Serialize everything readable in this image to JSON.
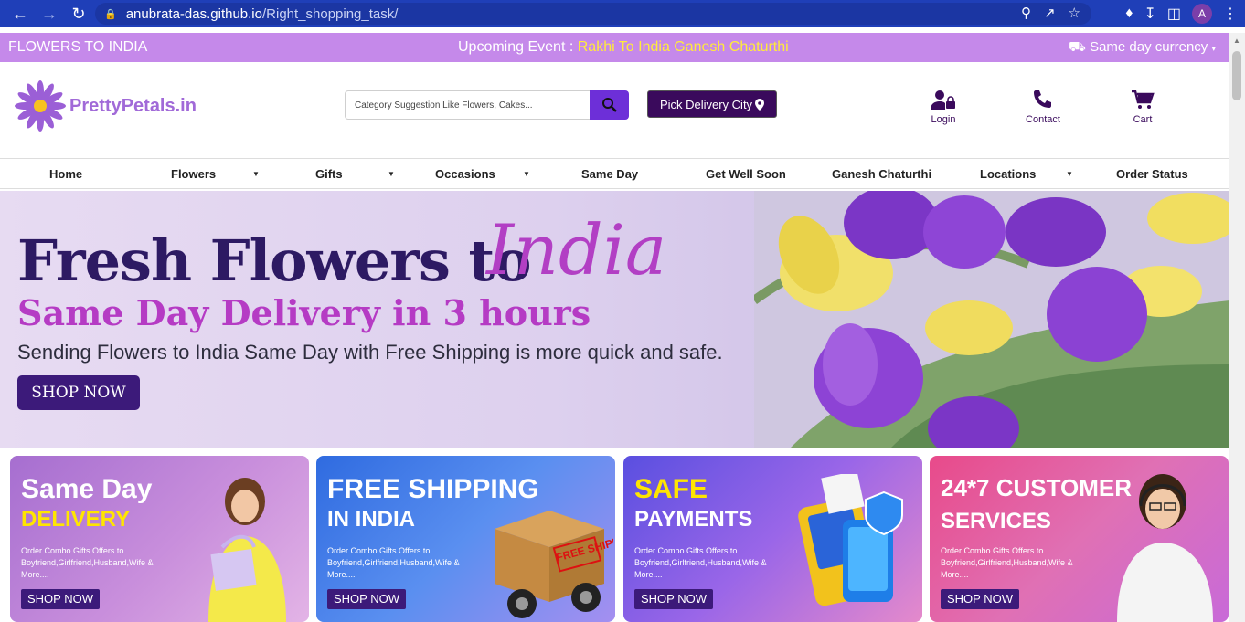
{
  "browser": {
    "url_host": "anubrata-das.github.io",
    "url_path": "/Right_shopping_task/",
    "avatar_letter": "A"
  },
  "topstrip": {
    "brand": "FLOWERS TO INDIA",
    "event_label": "Upcoming Event :",
    "event_highlight": "Rakhi To India Ganesh Chaturthi",
    "currency_label": "Same day  currency"
  },
  "header": {
    "logo_text": "PrettyPetals.in",
    "search_placeholder": "Category Suggestion Like Flowers, Cakes...",
    "pick_city": "Pick Delivery City",
    "login": "Login",
    "contact": "Contact",
    "cart": "Cart"
  },
  "menu": {
    "items": [
      "Home",
      "Flowers",
      "Gifts",
      "Occasions",
      "Same Day",
      "Get Well Soon",
      "Ganesh Chaturthi",
      "Locations",
      "Order Status"
    ]
  },
  "hero": {
    "title": "Fresh Flowers to",
    "title_script": "India",
    "subtitle": "Same Day Delivery in 3 hours",
    "text": "Sending Flowers to India Same Day with Free Shipping is more quick and safe.",
    "button": "SHOP NOW"
  },
  "cards": [
    {
      "line1": "Same Day",
      "line2": "DELIVERY",
      "desc": "Order Combo Gifts Offers to Boyfriend,Girlfriend,Husband,Wife & More....",
      "button": "SHOP NOW"
    },
    {
      "line1": "FREE SHIPPING",
      "line2": "IN INDIA",
      "desc": "Order Combo Gifts Offers to Boyfriend,Girlfriend,Husband,Wife & More....",
      "button": "SHOP NOW",
      "badge": "FREE SHIPPING"
    },
    {
      "line1": "SAFE",
      "line2": "PAYMENTS",
      "desc": "Order Combo Gifts Offers to Boyfriend,Girlfriend,Husband,Wife & More....",
      "button": "SHOP NOW"
    },
    {
      "line1": "24*7 CUSTOMER",
      "line2": "SERVICES",
      "desc": "Order Combo Gifts Offers to Boyfriend,Girlfriend,Husband,Wife & More....",
      "button": "SHOP NOW"
    }
  ],
  "colors": {
    "topstrip": "#c589ea",
    "brand_dark": "#3a0a5c",
    "search_button": "#6d2fd8",
    "highlight": "#ffeb3b"
  }
}
